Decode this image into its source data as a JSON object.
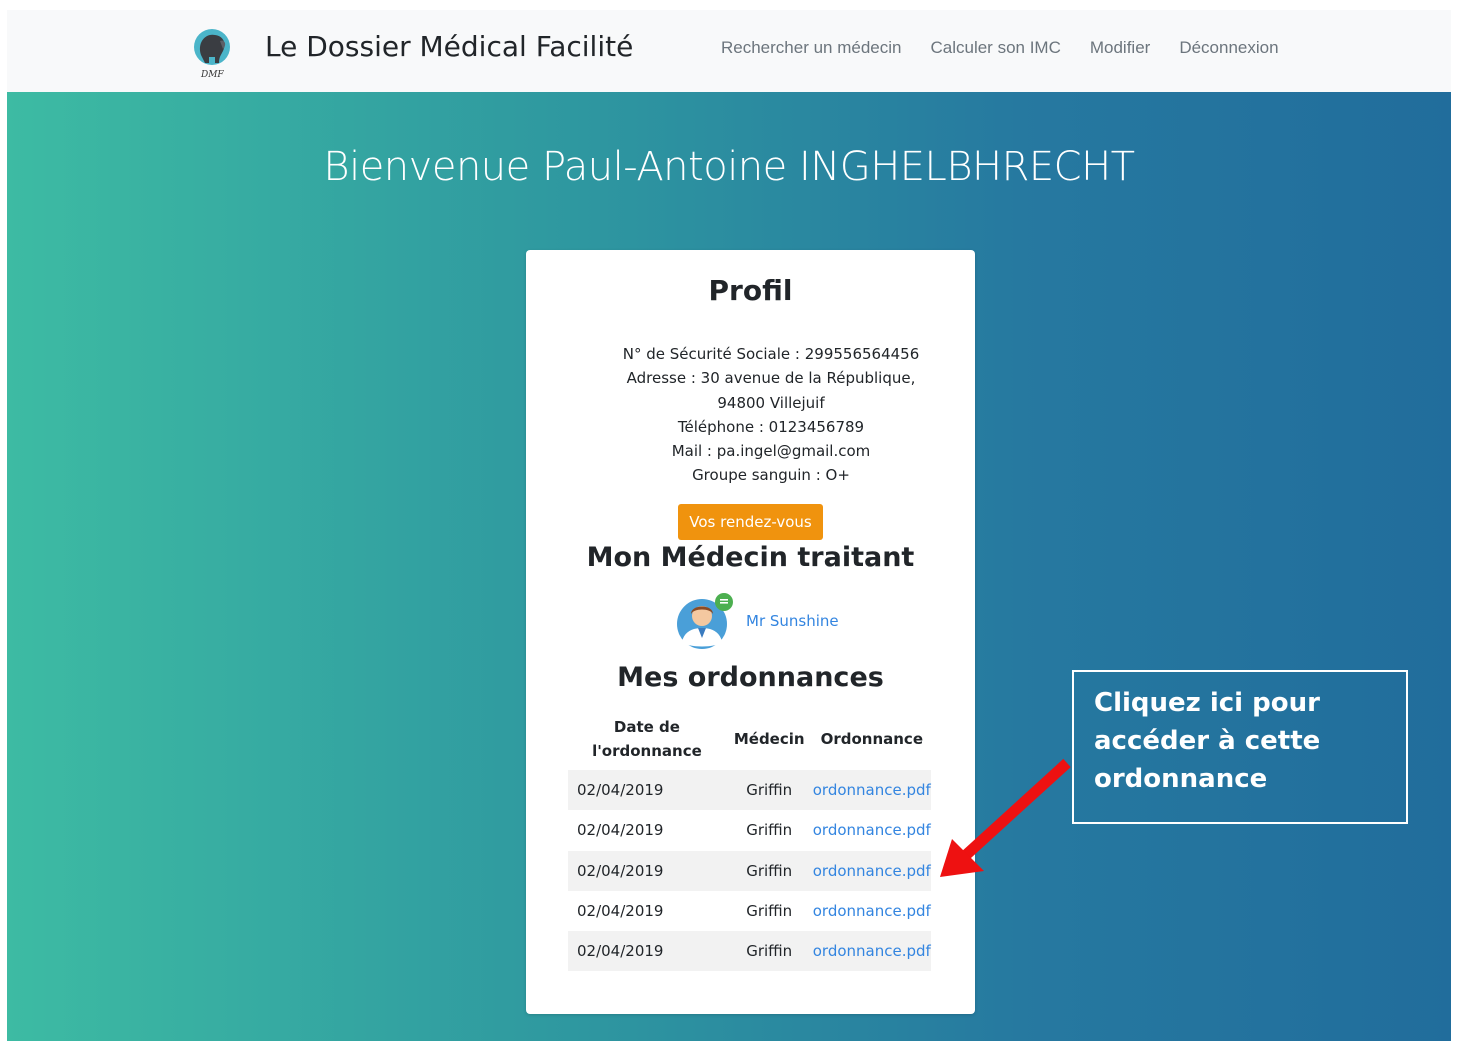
{
  "navbar": {
    "brand": "Le Dossier Médical Facilité",
    "logo_text": "DMF",
    "links": [
      "Rechercher un médecin",
      "Calculer son IMC",
      "Modifier",
      "Déconnexion"
    ]
  },
  "hero": {
    "welcome": "Bienvenue Paul-Antoine INGHELBHRECHT"
  },
  "profil": {
    "title": "Profil",
    "secu": "N° de Sécurité Sociale : 299556564456",
    "adresse": "Adresse : 30 avenue de la République, 94800 Villejuif",
    "telephone": "Téléphone : 0123456789",
    "mail": "Mail : pa.ingel@gmail.com",
    "groupe": "Groupe sanguin : O+",
    "rdv_button": "Vos rendez-vous"
  },
  "medecin": {
    "title": "Mon Médecin traitant",
    "name": "Mr Sunshine"
  },
  "ordonnances": {
    "title": "Mes ordonnances",
    "headers": [
      "Date de l'ordonnance",
      "Médecin",
      "Ordonnance"
    ],
    "rows": [
      [
        "02/04/2019",
        "Griffin",
        "ordonnance.pdf"
      ],
      [
        "02/04/2019",
        "Griffin",
        "ordonnance.pdf"
      ],
      [
        "02/04/2019",
        "Griffin",
        "ordonnance.pdf"
      ],
      [
        "02/04/2019",
        "Griffin",
        "ordonnance.pdf"
      ],
      [
        "02/04/2019",
        "Griffin",
        "ordonnance.pdf"
      ]
    ]
  },
  "callout": {
    "text": "Cliquez ici pour accéder à cette ordonnance"
  },
  "colors": {
    "accent_button": "#f0930e",
    "link": "#3385e0",
    "arrow": "#ee1111",
    "hero_start": "#3dbba3",
    "hero_end": "#216d9c"
  }
}
